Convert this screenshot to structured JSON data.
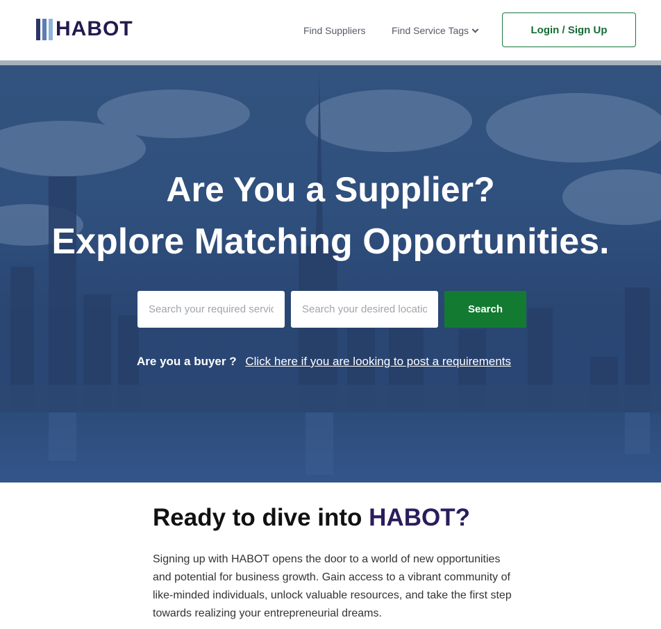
{
  "header": {
    "logo_text": "HABOT",
    "logo_icon": "vertical-bars-logo",
    "nav": {
      "find_suppliers": "Find Suppliers",
      "find_service_tags": "Find Service Tags"
    },
    "login_label": "Login / Sign Up"
  },
  "hero": {
    "title": "Are You a Supplier?",
    "subtitle": "Explore Matching Opportunities.",
    "search": {
      "service_placeholder": "Search your required services",
      "location_placeholder": "Search your desired location",
      "button_label": "Search"
    },
    "buyer_question": "Are you a buyer ?",
    "buyer_link": "Click here if you are looking to post a requirements"
  },
  "section": {
    "title_prefix": "Ready to dive into ",
    "title_brand": "HABOT?",
    "body": "Signing up with HABOT opens the door to a world of new opportunities and potential for business growth. Gain access to a vibrant community of like-minded individuals, unlock valuable resources, and take the first step towards realizing your entrepreneurial dreams."
  },
  "colors": {
    "brand_navy": "#231a4f",
    "accent_green": "#137a32",
    "hero_overlay": "#2f4f7d"
  }
}
